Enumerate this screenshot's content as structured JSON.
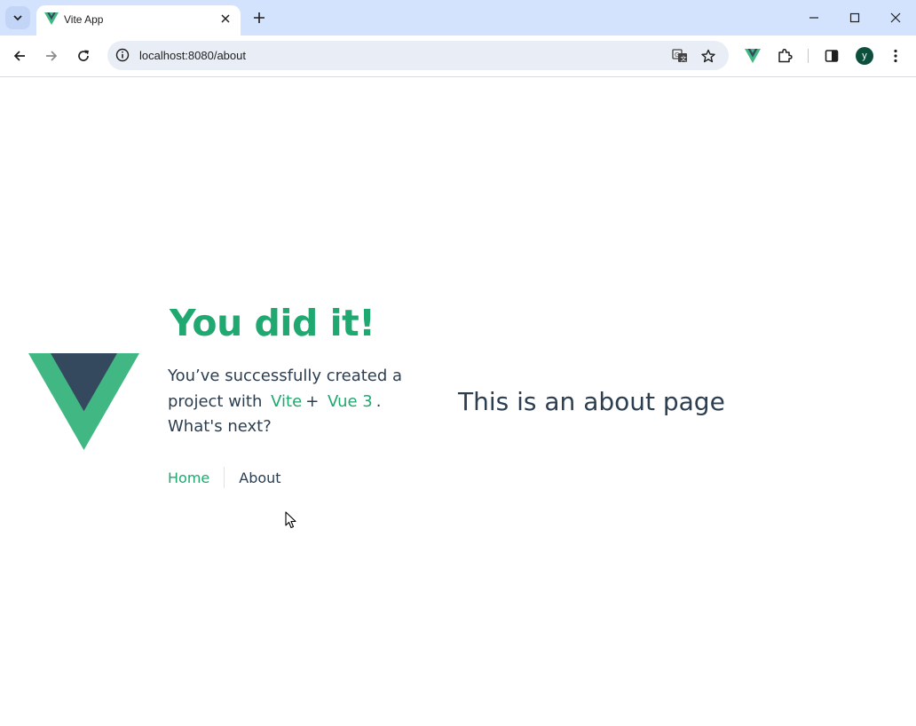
{
  "browser": {
    "tab": {
      "title": "Vite App",
      "favicon": "vue-logo-icon"
    },
    "address_bar": {
      "url": "localhost:8080/about"
    },
    "profile_initial": "y",
    "icons": [
      "tab-search-icon",
      "close-icon",
      "plus-icon",
      "minimize-icon",
      "maximize-icon",
      "window-close-icon",
      "back-icon",
      "forward-icon",
      "reload-icon",
      "site-info-icon",
      "translate-icon",
      "star-icon",
      "vue-devtools-icon",
      "extensions-icon",
      "side-panel-icon",
      "more-vert-icon"
    ]
  },
  "page": {
    "heading": "You did it!",
    "intro_before": "You’ve successfully created a project with",
    "link_vite": "Vite",
    "plus": "+",
    "link_vue": "Vue 3",
    "intro_after": ".",
    "whats_next": "What's next?",
    "nav": {
      "home": "Home",
      "about": "About"
    },
    "about_text": "This is an about page"
  },
  "colors": {
    "vue_green": "#41b883",
    "vue_dark": "#34495e",
    "heading_green": "#1fa971",
    "text": "#2c3e50",
    "tabbar_bg": "#d3e3fd"
  }
}
